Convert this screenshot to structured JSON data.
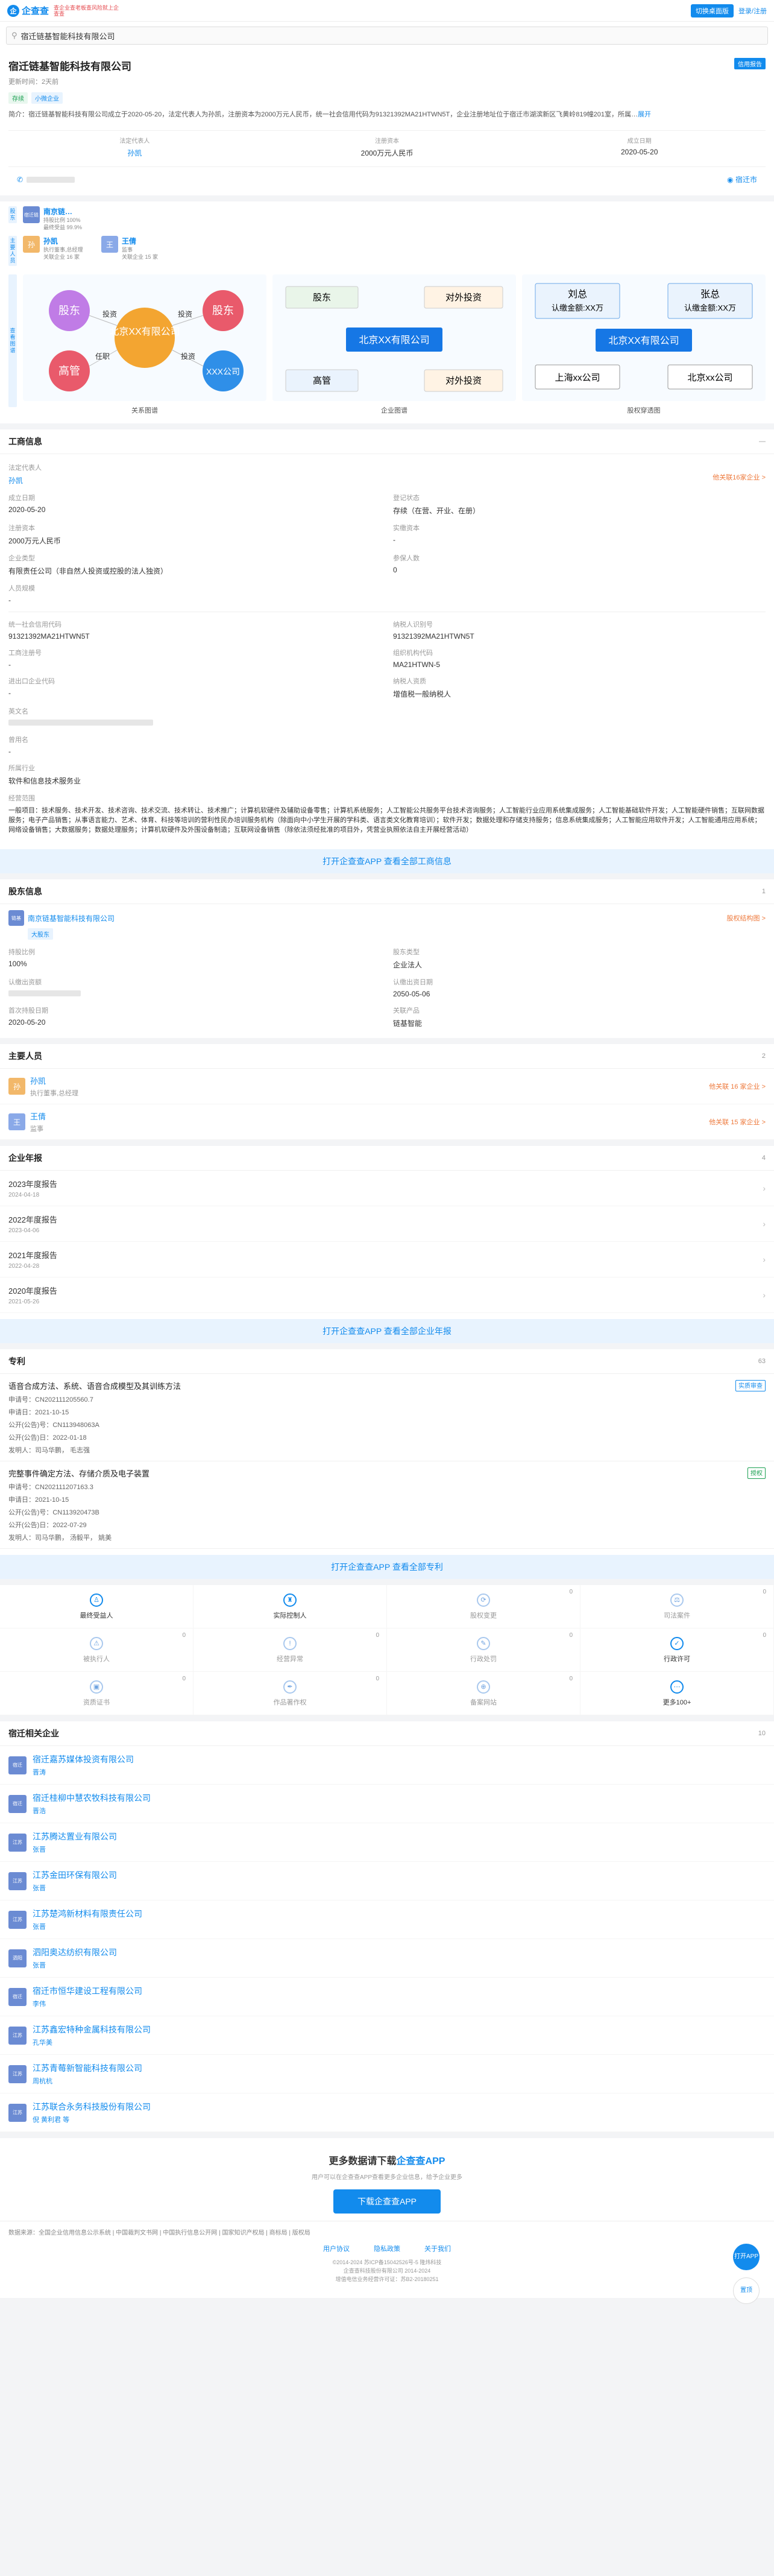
{
  "header": {
    "logo_mark": "企",
    "logo_text": "企查查",
    "slogan": "查企业查老板查风险就上企查查",
    "btn_login": "切换桌面版",
    "btn_vip": "登录/注册"
  },
  "search": {
    "value": "宿迁链基智能科技有限公司"
  },
  "company": {
    "name": "宿迁链基智能科技有限公司",
    "view_btn": "信用报告",
    "sub": "更新时间：2天前",
    "tags": [
      "存续",
      "小微企业"
    ],
    "intro_label": "简介：",
    "intro": "宿迁链基智能科技有限公司成立于2020-05-20，法定代表人为孙凯，注册资本为2000万元人民币，统一社会信用代码为91321392MA21HTWN5T，企业注册地址位于宿迁市湖滨新区飞黄岭819幢201室，所属…",
    "intro_more": "展开",
    "legal_label": "法定代表人",
    "legal": "孙凯",
    "capital_label": "注册资本",
    "capital": "2000万元人民币",
    "date_label": "成立日期",
    "date": "2020-05-20",
    "loc": "宿迁市"
  },
  "mini": {
    "gd_label": "股东",
    "gd": {
      "logo": "宿迁链",
      "name": "南京链…",
      "l1": "持股比例 100%",
      "l2": "最终受益 99.9%"
    },
    "zy_label": "主要人员",
    "people": [
      {
        "initial": "孙",
        "name": "孙凯",
        "l1": "执行董事,总经理",
        "l2": "关联企业 16 家"
      },
      {
        "initial": "王",
        "name": "王倩",
        "l1": "监事",
        "l2": "关联企业 15 家"
      }
    ]
  },
  "graphs": {
    "side": "查看图谱",
    "labels": [
      "关系图谱",
      "企业图谱",
      "股权穿透图"
    ],
    "g1": {
      "center": "北京XX有限公司",
      "n1": "股东",
      "n2": "股东",
      "n3": "高管",
      "n4": "XXX公司",
      "e1": "投资",
      "e2": "投资",
      "e3": "任职",
      "e4": "投资"
    },
    "g2": {
      "center": "北京XX有限公司",
      "a": "股东",
      "b": "对外投资",
      "c": "高管",
      "d": "对外投资"
    },
    "g3": {
      "center": "北京XX有限公司",
      "a": "刘总",
      "a2": "认缴金额:XX万",
      "b": "张总",
      "b2": "认缴金额:XX万",
      "c": "上海xx公司",
      "d": "北京xx公司"
    }
  },
  "biz": {
    "title": "工商信息",
    "legal_k": "法定代表人",
    "legal_v": "孙凯",
    "legal_note": "他关联16家企业 >",
    "rows": [
      [
        "成立日期",
        "2020-05-20",
        "登记状态",
        "存续（在营、开业、在册）"
      ],
      [
        "注册资本",
        "2000万元人民币",
        "实缴资本",
        "-"
      ],
      [
        "企业类型",
        "有限责任公司（非自然人投资或控股的法人独资）",
        "参保人数",
        "0"
      ],
      [
        "人员规模",
        "-",
        "",
        ""
      ]
    ],
    "rows2": [
      [
        "统一社会信用代码",
        "91321392MA21HTWN5T",
        "纳税人识别号",
        "91321392MA21HTWN5T"
      ],
      [
        "工商注册号",
        "-",
        "组织机构代码",
        "MA21HTWN-5"
      ],
      [
        "进出口企业代码",
        "-",
        "纳税人资质",
        "增值税一般纳税人"
      ]
    ],
    "addr_k": "英文名",
    "reg_k": "曾用名",
    "reg_v": "-",
    "ind_k": "所属行业",
    "ind_v": "软件和信息技术服务业",
    "scope_k": "经营范围",
    "scope": "一般项目：技术服务、技术开发、技术咨询、技术交流、技术转让、技术推广；计算机软硬件及辅助设备零售；计算机系统服务；人工智能公共服务平台技术咨询服务；人工智能行业应用系统集成服务；人工智能基础软件开发；人工智能硬件销售；互联网数据服务；电子产品销售；从事语言能力、艺术、体育、科技等培训的营利性民办培训服务机构（除面向中小学生开展的学科类、语言类文化教育培训）；软件开发；数据处理和存储支持服务；信息系统集成服务；人工智能应用软件开发；人工智能通用应用系统；网络设备销售；大数据服务；数据处理服务；计算机软硬件及外围设备制造；互联网设备销售（除依法须经批准的项目外，凭营业执照依法自主开展经营活动）",
    "open": "打开企查查APP 查看全部工商信息"
  },
  "sh": {
    "title": "股东信息",
    "count": "1",
    "name": "南京链基智能科技有限公司",
    "logo": "链基",
    "badge": "大股东",
    "note": "股权结构图 >",
    "rows": [
      [
        "持股比例",
        "100%",
        "股东类型",
        "企业法人"
      ],
      [
        "认缴出资额",
        "",
        "认缴出资日期",
        "2050-05-06"
      ],
      [
        "首次持股日期",
        "2020-05-20",
        "关联产品",
        "链基智能"
      ]
    ]
  },
  "mp": {
    "title": "主要人员",
    "count": "2",
    "people": [
      {
        "initial": "孙",
        "name": "孙凯",
        "role": "执行董事,总经理",
        "note": "他关联 16 家企业 >"
      },
      {
        "initial": "王",
        "name": "王倩",
        "role": "监事",
        "note": "他关联 15 家企业 >"
      }
    ]
  },
  "ar": {
    "title": "企业年报",
    "count": "4",
    "items": [
      [
        "2023年度报告",
        "2024-04-18"
      ],
      [
        "2022年度报告",
        "2023-04-06"
      ],
      [
        "2021年度报告",
        "2022-04-28"
      ],
      [
        "2020年度报告",
        "2021-05-26"
      ]
    ],
    "open": "打开企查查APP 查看全部企业年报"
  },
  "pt": {
    "title": "专利",
    "count": "63",
    "open": "打开企查查APP 查看全部专利",
    "items": [
      {
        "t": "语音合成方法、系统、语音合成模型及其训练方法",
        "tag": "实质审查",
        "lines": [
          "申请号：CN202111205560.7",
          "申请日：2021-10-15",
          "公开(公告)号：CN113948063A",
          "公开(公告)日：2022-01-18",
          "发明人：司马华鹏， 毛志强"
        ]
      },
      {
        "t": "完整事件确定方法、存储介质及电子装置",
        "tag": "授权",
        "lines": [
          "申请号：CN202111207163.3",
          "申请日：2021-10-15",
          "公开(公告)号：CN113920473B",
          "公开(公告)日：2022-07-29",
          "发明人：司马华鹏， 汤毅平， 姚美"
        ]
      }
    ]
  },
  "grid": [
    [
      "最终受益人",
      "",
      "1"
    ],
    [
      "实际控制人",
      "",
      "1"
    ],
    [
      "股权变更",
      "0",
      ""
    ],
    [
      "司法案件",
      "0",
      ""
    ],
    [
      "被执行人",
      "0",
      ""
    ],
    [
      "经营异常",
      "0",
      ""
    ],
    [
      "行政处罚",
      "0",
      ""
    ],
    [
      "行政许可",
      "0",
      "1"
    ],
    [
      "资质证书",
      "0",
      ""
    ],
    [
      "作品著作权",
      "0",
      ""
    ],
    [
      "备案网站",
      "0",
      ""
    ],
    [
      "更多100+",
      "",
      "1"
    ]
  ],
  "rel": {
    "title": "宿迁相关企业",
    "count": "10",
    "items": [
      [
        "宿迁嘉苏媒体投资有限公司",
        "晋涛"
      ],
      [
        "宿迁桂柳中慧农牧科技有限公司",
        "晋浩"
      ],
      [
        "江苏腾达置业有限公司",
        "张晋"
      ],
      [
        "江苏金田环保有限公司",
        "张晋"
      ],
      [
        "江苏楚鸿新材料有限责任公司",
        "张晋"
      ],
      [
        "泗阳奥达纺织有限公司",
        "张晋"
      ],
      [
        "宿迁市恒华建设工程有限公司",
        "李伟"
      ],
      [
        "江苏鑫宏特种金属科技有限公司",
        "孔华美"
      ],
      [
        "江苏青莓新智能科技有限公司",
        "周杭杭"
      ],
      [
        "江苏联合永务科技股份有限公司",
        "倪 黄利君 等"
      ]
    ]
  },
  "footer": {
    "h": "更多数据请下载",
    "h2": "企查查APP",
    "p": "用户可以在企查查APP查看更多企业信息，给予企业更多",
    "dl": "下载企查查APP",
    "links": "数据来源：全国企业信用信息公示系统 | 中国裁判文书网 | 中国执行信息公开网 | 国家知识产权局 | 商标局 | 版权局",
    "bl": [
      "用户协议",
      "隐私政策",
      "关于我们"
    ],
    "c1": "©2014-2024 苏ICP备15042526号-5 隆炜科技",
    "c2": "企查查科技股份有限公司 2014-2024",
    "c3": "增值电信业务经营许可证：苏B2-20180251"
  },
  "float": {
    "a": "打开APP",
    "b": "置顶"
  }
}
